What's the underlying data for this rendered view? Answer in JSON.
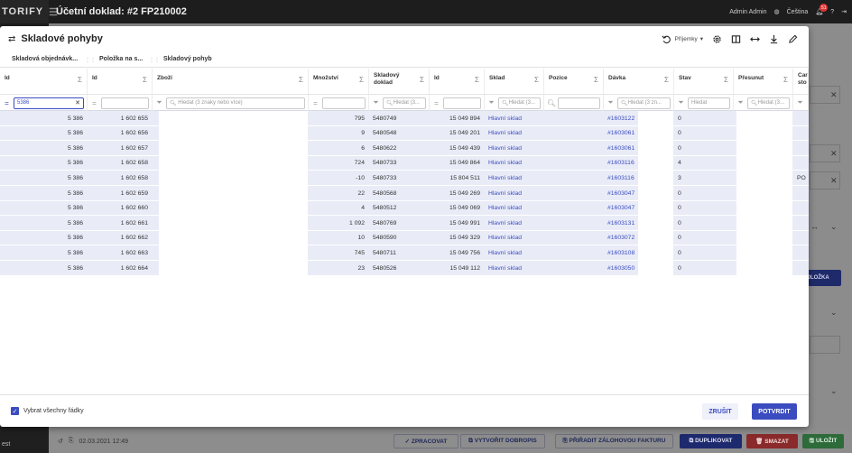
{
  "app": {
    "brand": "TORIFY",
    "document_title": "Účetní doklad: #2 FP210002",
    "user": "Admin Admin",
    "language": "Čeština",
    "notification_count": "51"
  },
  "bottom_bar": {
    "date": "02.03.2021 12:49",
    "footer_label": "est",
    "buttons": {
      "process": "✓ ZPRACOVAT",
      "credit_note": "⧉ VYTVOŘIT DOBROPIS",
      "assign_advance": "⎘ PŘIŘADIT ZÁLOHOVOU FAKTURU",
      "duplicate": "⧉ DUPLIKOVAT",
      "delete": "🗑 SMAZAT",
      "save": "🖫 ULOŽIT"
    },
    "side_button": "OLOŽKA"
  },
  "modal": {
    "title": "Skladové pohyby",
    "preset_label": "Příjemky",
    "tabs": [
      "Skladová objednávk...",
      "Položka na s...",
      "Skladový pohyb"
    ],
    "columns": [
      {
        "label": "Id",
        "sigma": "Σ"
      },
      {
        "label": "Id",
        "sigma": "Σ"
      },
      {
        "label": "Zboží",
        "sigma": "Σ"
      },
      {
        "label": "Množství",
        "sigma": "Σ"
      },
      {
        "label": "Skladový doklad",
        "sigma": "Σ"
      },
      {
        "label": "Id",
        "sigma": "Σ"
      },
      {
        "label": "Sklad",
        "sigma": "Σ"
      },
      {
        "label": "Pozice",
        "sigma": "Σ"
      },
      {
        "label": "Dávka",
        "sigma": "Σ"
      },
      {
        "label": "Stav",
        "sigma": "Σ"
      },
      {
        "label": "Přesunut",
        "sigma": "Σ"
      },
      {
        "label": "Car sto",
        "sigma": ""
      }
    ],
    "filters": {
      "id_value": "5386",
      "zbozi_placeholder": "Hledat (3 znaky nebo více)",
      "doklad_placeholder": "Hledat (3...",
      "sklad_placeholder": "Hledat (3...",
      "davka_placeholder": "Hledat (3 zn...",
      "stav_placeholder": "Hledat",
      "presunut_placeholder": "Hledat (3..."
    },
    "rows": [
      {
        "id": "5 386",
        "id2": "1 602 655",
        "qty": "795",
        "doc": "5480749",
        "id3": "15 049 894",
        "sklad": "Hlavní sklad",
        "davka": "#1603122",
        "stav": "0",
        "car": ""
      },
      {
        "id": "5 386",
        "id2": "1 602 656",
        "qty": "9",
        "doc": "5480548",
        "id3": "15 049 201",
        "sklad": "Hlavní sklad",
        "davka": "#1603061",
        "stav": "0",
        "car": ""
      },
      {
        "id": "5 386",
        "id2": "1 602 657",
        "qty": "6",
        "doc": "5480622",
        "id3": "15 049 439",
        "sklad": "Hlavní sklad",
        "davka": "#1603061",
        "stav": "0",
        "car": ""
      },
      {
        "id": "5 386",
        "id2": "1 602 658",
        "qty": "724",
        "doc": "5480733",
        "id3": "15 049 864",
        "sklad": "Hlavní sklad",
        "davka": "#1603116",
        "stav": "4",
        "car": ""
      },
      {
        "id": "5 386",
        "id2": "1 602 658",
        "qty": "-10",
        "doc": "5480733",
        "id3": "15 804 511",
        "sklad": "Hlavní sklad",
        "davka": "#1603116",
        "stav": "3",
        "car": "PO"
      },
      {
        "id": "5 386",
        "id2": "1 602 659",
        "qty": "22",
        "doc": "5480568",
        "id3": "15 049 269",
        "sklad": "Hlavní sklad",
        "davka": "#1603047",
        "stav": "0",
        "car": ""
      },
      {
        "id": "5 386",
        "id2": "1 602 660",
        "qty": "4",
        "doc": "5480512",
        "id3": "15 049 069",
        "sklad": "Hlavní sklad",
        "davka": "#1603047",
        "stav": "0",
        "car": ""
      },
      {
        "id": "5 386",
        "id2": "1 602 661",
        "qty": "1 092",
        "doc": "5480769",
        "id3": "15 049 991",
        "sklad": "Hlavní sklad",
        "davka": "#1603131",
        "stav": "0",
        "car": ""
      },
      {
        "id": "5 386",
        "id2": "1 602 662",
        "qty": "10",
        "doc": "5480590",
        "id3": "15 049 329",
        "sklad": "Hlavní sklad",
        "davka": "#1603072",
        "stav": "0",
        "car": ""
      },
      {
        "id": "5 386",
        "id2": "1 602 663",
        "qty": "745",
        "doc": "5480711",
        "id3": "15 049 756",
        "sklad": "Hlavní sklad",
        "davka": "#1603108",
        "stav": "0",
        "car": ""
      },
      {
        "id": "5 386",
        "id2": "1 602 664",
        "qty": "23",
        "doc": "5480526",
        "id3": "15 049 112",
        "sklad": "Hlavní sklad",
        "davka": "#1603050",
        "stav": "0",
        "car": ""
      }
    ],
    "footer": {
      "select_all": "Vybrat všechny řádky",
      "cancel": "ZRUŠIT",
      "confirm": "POTVRDIT"
    }
  },
  "colors": {
    "accent": "#3b4cc0",
    "row_bg": "#e9ecf7",
    "topbar": "#1d1d1d"
  }
}
